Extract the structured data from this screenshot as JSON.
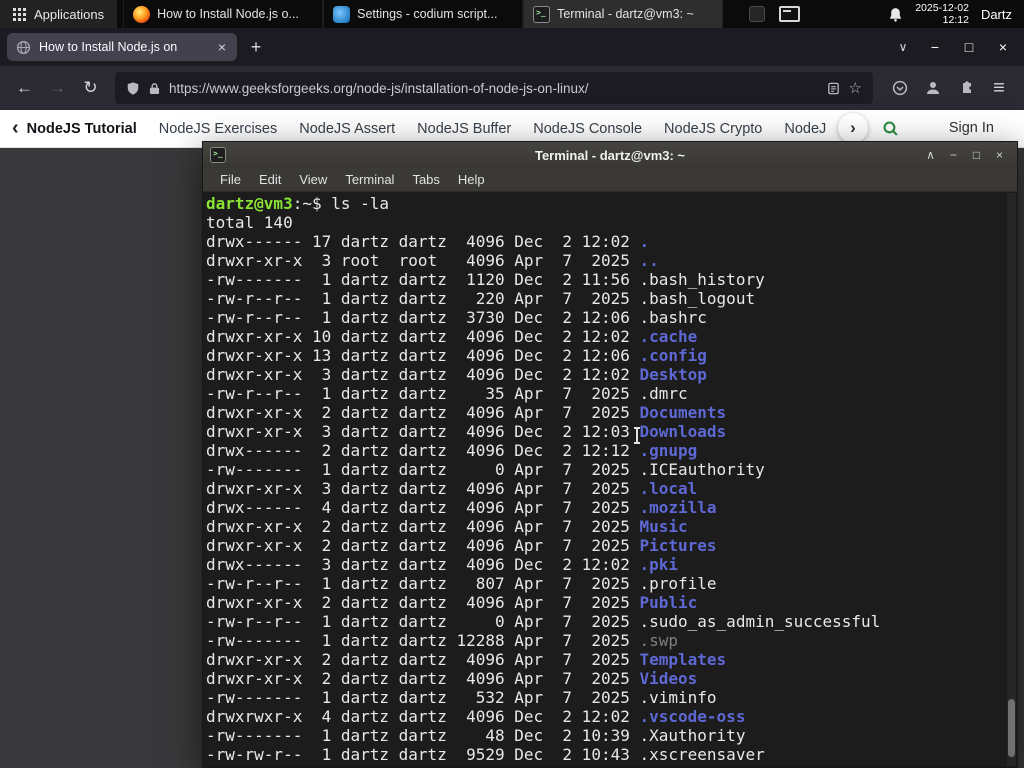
{
  "icons": {
    "minimize": "−",
    "maximize": "□",
    "close": "×",
    "shade": "∧",
    "chevron_down": "∨",
    "back": "←",
    "forward": "→",
    "reload": "↻",
    "new_tab": "+",
    "star": "☆",
    "menu": "≡",
    "nav_left": "‹",
    "nav_right": "›"
  },
  "panel": {
    "applications_label": "Applications",
    "tasks": [
      {
        "icon": "firefox",
        "title": "How to Install Node.js o...",
        "active": false
      },
      {
        "icon": "codium",
        "title": "Settings - codium script...",
        "active": false
      },
      {
        "icon": "terminal",
        "title": "Terminal - dartz@vm3: ~",
        "active": true
      }
    ],
    "clock": {
      "date": "2025-12-02",
      "time": "12:12"
    },
    "user": "Dartz"
  },
  "browser": {
    "tab_title": "How to Install Node.js on",
    "window_controls": [
      "minimize",
      "maximize",
      "close"
    ],
    "url": "https://www.geeksforgeeks.org/node-js/installation-of-node-js-on-linux/",
    "accent_green": "#2f8d46",
    "nav_links": [
      "NodeJS Tutorial",
      "NodeJS Exercises",
      "NodeJS Assert",
      "NodeJS Buffer",
      "NodeJS Console",
      "NodeJS Crypto",
      "NodeJS DNS",
      "Node"
    ],
    "sign_in_label": "Sign In"
  },
  "terminal": {
    "window_title": "Terminal - dartz@vm3: ~",
    "window_controls": [
      "shade",
      "minimize",
      "maximize",
      "close"
    ],
    "menu": [
      "File",
      "Edit",
      "View",
      "Terminal",
      "Tabs",
      "Help"
    ],
    "prompt": {
      "user_host": "dartz@vm3",
      "separator": ":",
      "cwd": "~",
      "suffix": "$ ",
      "command": "ls -la"
    },
    "total_line": "total 140",
    "colors": {
      "background": "#1c1c1c",
      "foreground": "#e8e8e8",
      "prompt_green": "#8ae234",
      "directory": "#5e68d4",
      "dim": "#7f7f7f"
    },
    "entries": [
      {
        "meta": "drwx------ 17 dartz dartz  4096 Dec  2 12:02 ",
        "name": ".",
        "kind": "dir"
      },
      {
        "meta": "drwxr-xr-x  3 root  root   4096 Apr  7  2025 ",
        "name": "..",
        "kind": "dir"
      },
      {
        "meta": "-rw-------  1 dartz dartz  1120 Dec  2 11:56 ",
        "name": ".bash_history",
        "kind": "file"
      },
      {
        "meta": "-rw-r--r--  1 dartz dartz   220 Apr  7  2025 ",
        "name": ".bash_logout",
        "kind": "file"
      },
      {
        "meta": "-rw-r--r--  1 dartz dartz  3730 Dec  2 12:06 ",
        "name": ".bashrc",
        "kind": "file"
      },
      {
        "meta": "drwxr-xr-x 10 dartz dartz  4096 Dec  2 12:02 ",
        "name": ".cache",
        "kind": "dir"
      },
      {
        "meta": "drwxr-xr-x 13 dartz dartz  4096 Dec  2 12:06 ",
        "name": ".config",
        "kind": "dir"
      },
      {
        "meta": "drwxr-xr-x  3 dartz dartz  4096 Dec  2 12:02 ",
        "name": "Desktop",
        "kind": "dir"
      },
      {
        "meta": "-rw-r--r--  1 dartz dartz    35 Apr  7  2025 ",
        "name": ".dmrc",
        "kind": "file"
      },
      {
        "meta": "drwxr-xr-x  2 dartz dartz  4096 Apr  7  2025 ",
        "name": "Documents",
        "kind": "dir"
      },
      {
        "meta": "drwxr-xr-x  3 dartz dartz  4096 Dec  2 12:03 ",
        "name": "Downloads",
        "kind": "dir"
      },
      {
        "meta": "drwx------  2 dartz dartz  4096 Dec  2 12:12 ",
        "name": ".gnupg",
        "kind": "dir"
      },
      {
        "meta": "-rw-------  1 dartz dartz     0 Apr  7  2025 ",
        "name": ".ICEauthority",
        "kind": "file"
      },
      {
        "meta": "drwxr-xr-x  3 dartz dartz  4096 Apr  7  2025 ",
        "name": ".local",
        "kind": "dir"
      },
      {
        "meta": "drwx------  4 dartz dartz  4096 Apr  7  2025 ",
        "name": ".mozilla",
        "kind": "dir"
      },
      {
        "meta": "drwxr-xr-x  2 dartz dartz  4096 Apr  7  2025 ",
        "name": "Music",
        "kind": "dir"
      },
      {
        "meta": "drwxr-xr-x  2 dartz dartz  4096 Apr  7  2025 ",
        "name": "Pictures",
        "kind": "dir"
      },
      {
        "meta": "drwx------  3 dartz dartz  4096 Dec  2 12:02 ",
        "name": ".pki",
        "kind": "dir"
      },
      {
        "meta": "-rw-r--r--  1 dartz dartz   807 Apr  7  2025 ",
        "name": ".profile",
        "kind": "file"
      },
      {
        "meta": "drwxr-xr-x  2 dartz dartz  4096 Apr  7  2025 ",
        "name": "Public",
        "kind": "dir"
      },
      {
        "meta": "-rw-r--r--  1 dartz dartz     0 Apr  7  2025 ",
        "name": ".sudo_as_admin_successful",
        "kind": "file"
      },
      {
        "meta": "-rw-------  1 dartz dartz 12288 Apr  7  2025 ",
        "name": ".swp",
        "kind": "dim"
      },
      {
        "meta": "drwxr-xr-x  2 dartz dartz  4096 Apr  7  2025 ",
        "name": "Templates",
        "kind": "dir"
      },
      {
        "meta": "drwxr-xr-x  2 dartz dartz  4096 Apr  7  2025 ",
        "name": "Videos",
        "kind": "dir"
      },
      {
        "meta": "-rw-------  1 dartz dartz   532 Apr  7  2025 ",
        "name": ".viminfo",
        "kind": "file"
      },
      {
        "meta": "drwxrwxr-x  4 dartz dartz  4096 Dec  2 12:02 ",
        "name": ".vscode-oss",
        "kind": "dir"
      },
      {
        "meta": "-rw-------  1 dartz dartz    48 Dec  2 10:39 ",
        "name": ".Xauthority",
        "kind": "file"
      },
      {
        "meta": "-rw-rw-r--  1 dartz dartz  9529 Dec  2 10:43 ",
        "name": ".xscreensaver",
        "kind": "file"
      }
    ]
  }
}
